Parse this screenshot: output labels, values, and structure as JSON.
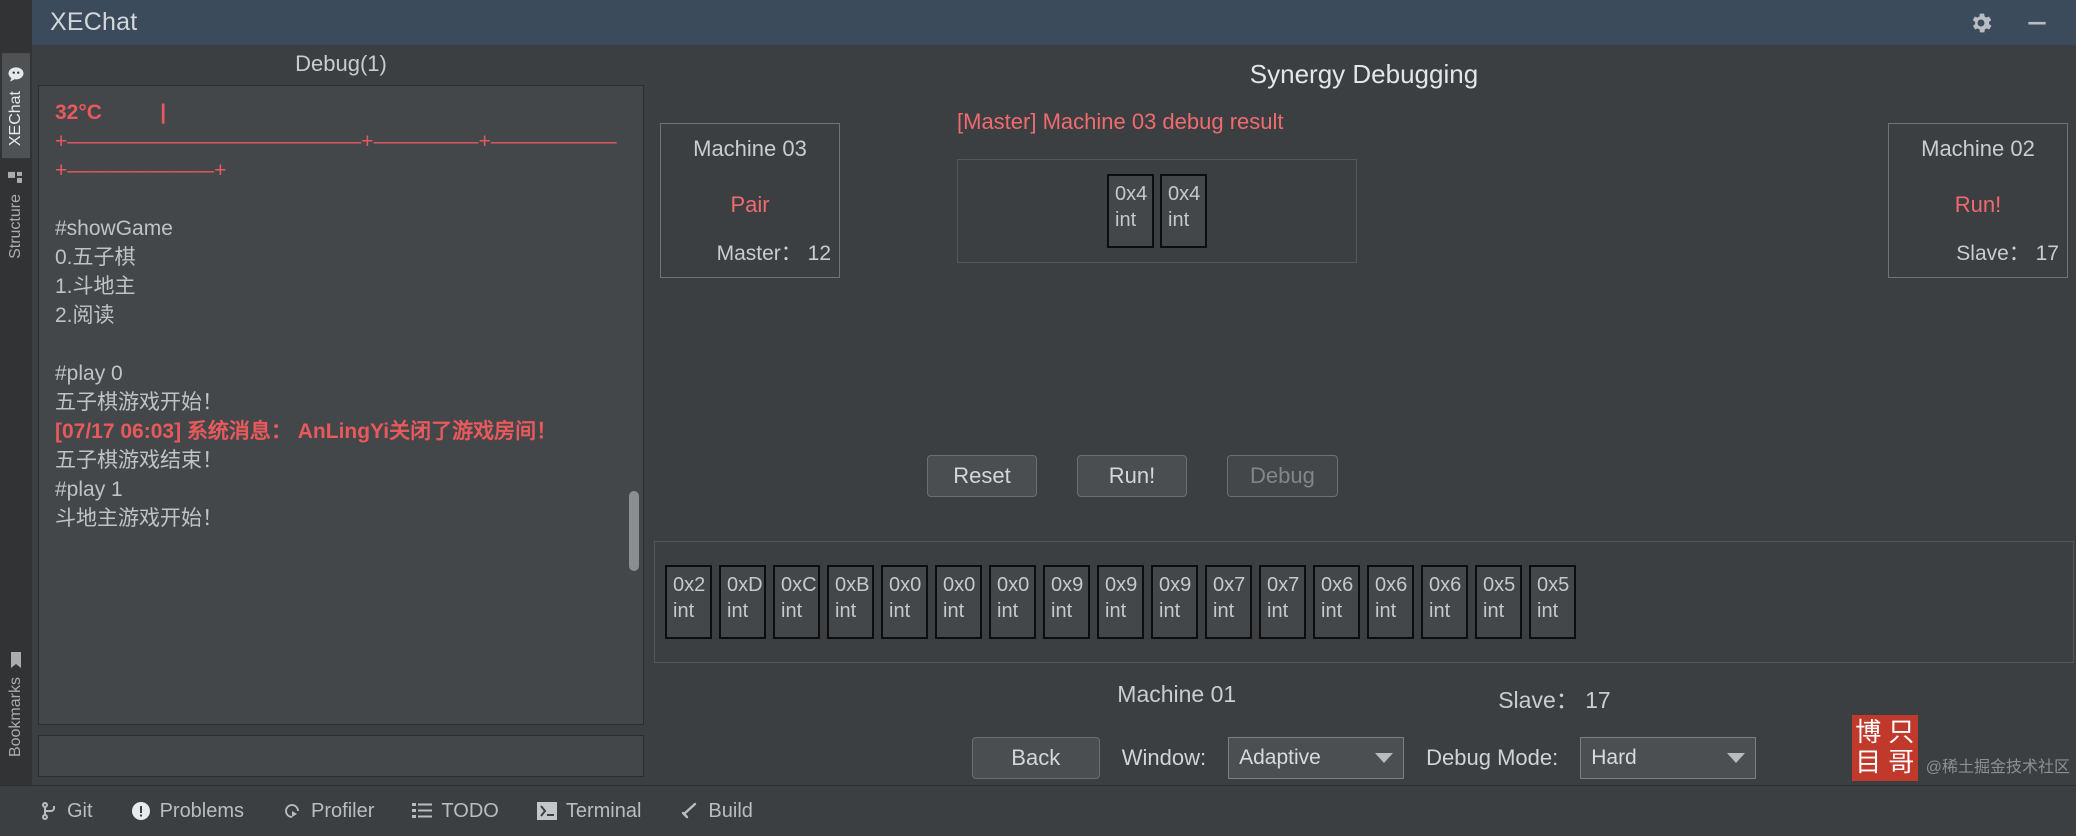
{
  "titlebar": {
    "app_title": "XEChat",
    "settings_icon": "gear-icon",
    "minimize_icon": "minimize-icon"
  },
  "rail": {
    "items": [
      {
        "label": "XEChat",
        "icon": "chat-bubble-icon",
        "active": true
      },
      {
        "label": "Structure",
        "icon": "structure-icon",
        "active": false
      },
      {
        "label": "Bookmarks",
        "icon": "bookmark-icon",
        "active": false
      }
    ]
  },
  "left_panel": {
    "title": "Debug(1)",
    "log_lines": [
      {
        "text": "32°C          |",
        "style": "red"
      },
      {
        "text": "+——————————————+—————+——————",
        "style": "redn"
      },
      {
        "text": "+———————+",
        "style": "redn"
      },
      {
        "text": "",
        "style": "plain"
      },
      {
        "text": "#showGame",
        "style": "plain"
      },
      {
        "text": "0.五子棋",
        "style": "plain"
      },
      {
        "text": "1.斗地主",
        "style": "plain"
      },
      {
        "text": "2.阅读",
        "style": "plain"
      },
      {
        "text": "",
        "style": "plain"
      },
      {
        "text": "#play 0",
        "style": "plain"
      },
      {
        "text": "五子棋游戏开始！",
        "style": "plain"
      },
      {
        "text": "[07/17 06:03] 系统消息： AnLingYi关闭了游戏房间！",
        "style": "red"
      },
      {
        "text": "五子棋游戏结束！",
        "style": "plain"
      },
      {
        "text": "#play 1",
        "style": "plain"
      },
      {
        "text": "斗地主游戏开始！",
        "style": "plain"
      }
    ],
    "input_value": "",
    "input_placeholder": ""
  },
  "right_panel": {
    "title": "Synergy Debugging",
    "machine_left": {
      "name": "Machine 03",
      "state": "Pair",
      "role": "Master： 12"
    },
    "machine_right": {
      "name": "Machine 02",
      "state": "Run!",
      "role": "Slave： 17"
    },
    "debug_result": {
      "label": "[Master] Machine 03 debug result",
      "cells": [
        {
          "value": "0x4",
          "type": "int"
        },
        {
          "value": "0x4",
          "type": "int"
        }
      ]
    },
    "buttons": [
      {
        "label": "Reset",
        "name": "reset-button",
        "disabled": false
      },
      {
        "label": "Run!",
        "name": "run-button",
        "disabled": false
      },
      {
        "label": "Debug",
        "name": "debug-button",
        "disabled": true
      }
    ],
    "memory_cells": [
      {
        "value": "0x2",
        "type": "int"
      },
      {
        "value": "0xD",
        "type": "int"
      },
      {
        "value": "0xC",
        "type": "int"
      },
      {
        "value": "0xB",
        "type": "int"
      },
      {
        "value": "0x0",
        "type": "int"
      },
      {
        "value": "0x0",
        "type": "int"
      },
      {
        "value": "0x0",
        "type": "int"
      },
      {
        "value": "0x9",
        "type": "int"
      },
      {
        "value": "0x9",
        "type": "int"
      },
      {
        "value": "0x9",
        "type": "int"
      },
      {
        "value": "0x7",
        "type": "int"
      },
      {
        "value": "0x7",
        "type": "int"
      },
      {
        "value": "0x6",
        "type": "int"
      },
      {
        "value": "0x6",
        "type": "int"
      },
      {
        "value": "0x6",
        "type": "int"
      },
      {
        "value": "0x5",
        "type": "int"
      },
      {
        "value": "0x5",
        "type": "int"
      }
    ],
    "machine01_label": "Machine 01",
    "machine01_slave": "Slave： 17",
    "back_label": "Back",
    "window_label": "Window:",
    "window_value": "Adaptive",
    "debug_mode_label": "Debug Mode:",
    "debug_mode_value": "Hard"
  },
  "watermark": {
    "stamp_chars": [
      "博",
      "只",
      "目",
      "哥"
    ],
    "credit": "@稀土掘金技术社区"
  },
  "statusbar": {
    "items": [
      {
        "label": "Git",
        "icon": "git-branch-icon"
      },
      {
        "label": "Problems",
        "icon": "warning-icon"
      },
      {
        "label": "Profiler",
        "icon": "profiler-icon"
      },
      {
        "label": "TODO",
        "icon": "list-icon"
      },
      {
        "label": "Terminal",
        "icon": "terminal-icon"
      },
      {
        "label": "Build",
        "icon": "hammer-icon"
      }
    ]
  },
  "colors": {
    "accent_red": "#ef6b6e",
    "titlebar": "#3c4b5c",
    "panel_bg": "#3c3f41"
  }
}
